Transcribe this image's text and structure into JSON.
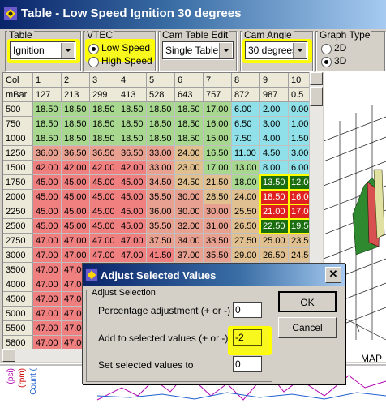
{
  "window": {
    "title": "Table - Low Speed Ignition 30 degrees"
  },
  "controls": {
    "table": {
      "label": "Table",
      "value": "Ignition"
    },
    "vtec": {
      "label": "VTEC",
      "options": [
        "Low Speed",
        "High Speed"
      ],
      "selected": "Low Speed"
    },
    "cam_table_edit": {
      "label": "Cam Table Edit",
      "value": "Single Table"
    },
    "cam_angle": {
      "label": "Cam Angle",
      "value": "30 degrees"
    },
    "graph_type": {
      "label": "Graph Type",
      "options": [
        "2D",
        "3D"
      ],
      "selected": "3D"
    }
  },
  "grid": {
    "col_header_label": "Col",
    "mbar_label": "mBar",
    "columns": [
      "1",
      "2",
      "3",
      "4",
      "5",
      "6",
      "7",
      "8",
      "9",
      "10"
    ],
    "mbar": [
      "127",
      "213",
      "299",
      "413",
      "528",
      "643",
      "757",
      "872",
      "987",
      "0.5"
    ],
    "rows": [
      {
        "rpm": "500",
        "vals": [
          "18.50",
          "18.50",
          "18.50",
          "18.50",
          "18.50",
          "18.50",
          "17.00",
          "6.00",
          "2.00",
          "0.00"
        ]
      },
      {
        "rpm": "750",
        "vals": [
          "18.50",
          "18.50",
          "18.50",
          "18.50",
          "18.50",
          "18.50",
          "16.00",
          "6.50",
          "3.00",
          "1.00"
        ]
      },
      {
        "rpm": "1000",
        "vals": [
          "18.50",
          "18.50",
          "18.50",
          "18.50",
          "18.50",
          "18.50",
          "15.00",
          "7.50",
          "4.00",
          "1.50"
        ]
      },
      {
        "rpm": "1250",
        "vals": [
          "36.00",
          "36.50",
          "36.50",
          "36.50",
          "33.00",
          "24.00",
          "16.50",
          "11.00",
          "4.50",
          "3.00"
        ]
      },
      {
        "rpm": "1500",
        "vals": [
          "42.00",
          "42.00",
          "42.00",
          "42.00",
          "33.00",
          "23.00",
          "17.00",
          "13.00",
          "8.00",
          "6.00"
        ]
      },
      {
        "rpm": "1750",
        "vals": [
          "45.00",
          "45.00",
          "45.00",
          "45.00",
          "34.50",
          "24.50",
          "21.50",
          "18.00",
          "13.50",
          "12.00"
        ]
      },
      {
        "rpm": "2000",
        "vals": [
          "45.00",
          "45.00",
          "45.00",
          "45.00",
          "35.50",
          "30.00",
          "28.50",
          "24.00",
          "18.50",
          "16.00"
        ]
      },
      {
        "rpm": "2250",
        "vals": [
          "45.00",
          "45.00",
          "45.00",
          "45.00",
          "36.00",
          "30.00",
          "30.00",
          "25.50",
          "21.00",
          "17.00"
        ]
      },
      {
        "rpm": "2500",
        "vals": [
          "45.00",
          "45.00",
          "45.00",
          "45.00",
          "35.50",
          "32.00",
          "31.00",
          "26.50",
          "22.50",
          "19.50"
        ]
      },
      {
        "rpm": "2750",
        "vals": [
          "47.00",
          "47.00",
          "47.00",
          "47.00",
          "37.50",
          "34.00",
          "33.50",
          "27.50",
          "25.00",
          "23.50"
        ]
      },
      {
        "rpm": "3000",
        "vals": [
          "47.00",
          "47.00",
          "47.00",
          "47.00",
          "41.50",
          "37.00",
          "35.50",
          "29.00",
          "26.50",
          "24.50"
        ]
      },
      {
        "rpm": "3500",
        "vals": [
          "47.00",
          "47.00",
          "",
          "",
          "",
          "",
          "",
          "",
          "",
          ""
        ]
      },
      {
        "rpm": "4000",
        "vals": [
          "47.00",
          "47.00",
          "",
          "",
          "",
          "",
          "",
          "",
          "",
          ""
        ]
      },
      {
        "rpm": "4500",
        "vals": [
          "47.00",
          "47.00",
          "",
          "",
          "",
          "",
          "",
          "",
          "",
          ""
        ]
      },
      {
        "rpm": "5000",
        "vals": [
          "47.00",
          "47.00",
          "",
          "",
          "",
          "",
          "",
          "",
          "",
          ""
        ]
      },
      {
        "rpm": "5500",
        "vals": [
          "47.00",
          "47.00",
          "",
          "",
          "",
          "",
          "",
          "",
          "",
          ""
        ]
      },
      {
        "rpm": "5800",
        "vals": [
          "47.00",
          "47.00",
          "",
          "",
          "",
          "",
          "",
          "",
          "",
          ""
        ]
      }
    ]
  },
  "graph": {
    "axis_label": "MAP ("
  },
  "bottom_chart": {
    "labels": [
      "(psi)",
      "(rpm)",
      "Count ("
    ]
  },
  "dialog": {
    "title": "Adjust Selected Values",
    "group_label": "Adjust Selection",
    "fields": [
      {
        "label": "Percentage adjustment (+ or -)",
        "value": "0"
      },
      {
        "label": "Add to selected values (+ or -)",
        "value": "-2"
      },
      {
        "label": "Set selected values to",
        "value": "0"
      }
    ],
    "ok_label": "OK",
    "cancel_label": "Cancel",
    "close_glyph": "✕"
  },
  "colors": {
    "cool": "#8fe0e8",
    "green": "#a8d890",
    "warm": "#e8a090",
    "red": "#f07f80",
    "sel_green": "#1a6e10",
    "sel_red": "#e02020",
    "highlight": "#ffff00"
  }
}
